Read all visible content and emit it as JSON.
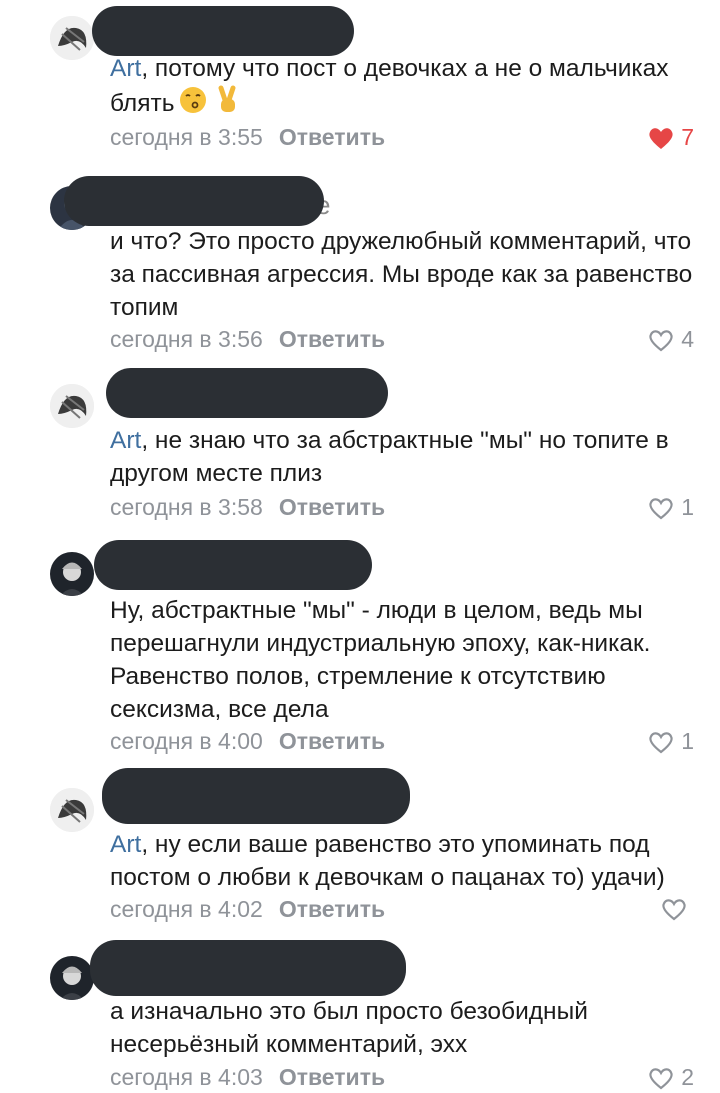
{
  "comments": [
    {
      "mention": "Art",
      "text": ", потому что пост о девочках а не о мальчиках блять",
      "emojis": [
        "kissing-face-emoji",
        "victory-hand-emoji"
      ],
      "time": "сегодня в 3:55",
      "reply": "Ответить",
      "likes": "7",
      "liked": true
    },
    {
      "name_peek": "е",
      "text": "и что? Это просто дружелюбный комментарий, что за пассивная агрессия. Мы вроде как за равенство топим",
      "time": "сегодня в 3:56",
      "reply": "Ответить",
      "likes": "4",
      "liked": false
    },
    {
      "mention": "Art",
      "text": ", не знаю что за абстрактные \"мы\" но топите в другом месте плиз",
      "time": "сегодня в 3:58",
      "reply": "Ответить",
      "likes": "1",
      "liked": false
    },
    {
      "text": "Ну, абстрактные \"мы\" - люди в целом, ведь мы перешагнули индустриальную эпоху, как-никак. Равенство полов, стремление к отсутствию сексизма, все дела",
      "time": "сегодня в 4:00",
      "reply": "Ответить",
      "likes": "1",
      "liked": false
    },
    {
      "mention": "Art",
      "text": ", ну если ваше равенство это упоминать под постом о любви к девочкам о пацанах то) удачи)",
      "time": "сегодня в 4:02",
      "reply": "Ответить",
      "likes": "",
      "liked": false
    },
    {
      "text": "а изначально это был просто безобидный несерьёзный комментарий, эхх",
      "time": "сегодня в 4:03",
      "reply": "Ответить",
      "likes": "2",
      "liked": false
    }
  ],
  "colors": {
    "mention": "#3f6f9f",
    "meta": "#8f9399",
    "liked": "#e64646",
    "redaction": "#2b2f34"
  }
}
